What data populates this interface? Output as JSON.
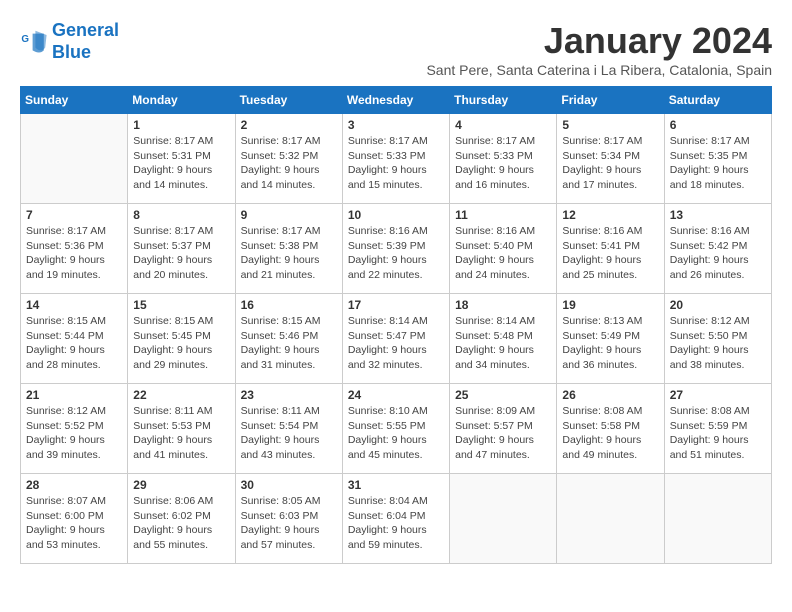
{
  "header": {
    "logo_line1": "General",
    "logo_line2": "Blue",
    "month": "January 2024",
    "subtitle": "Sant Pere, Santa Caterina i La Ribera, Catalonia, Spain"
  },
  "weekdays": [
    "Sunday",
    "Monday",
    "Tuesday",
    "Wednesday",
    "Thursday",
    "Friday",
    "Saturday"
  ],
  "weeks": [
    [
      {
        "day": "",
        "empty": true
      },
      {
        "day": "1",
        "sunrise": "8:17 AM",
        "sunset": "5:31 PM",
        "daylight": "9 hours and 14 minutes."
      },
      {
        "day": "2",
        "sunrise": "8:17 AM",
        "sunset": "5:32 PM",
        "daylight": "9 hours and 14 minutes."
      },
      {
        "day": "3",
        "sunrise": "8:17 AM",
        "sunset": "5:33 PM",
        "daylight": "9 hours and 15 minutes."
      },
      {
        "day": "4",
        "sunrise": "8:17 AM",
        "sunset": "5:33 PM",
        "daylight": "9 hours and 16 minutes."
      },
      {
        "day": "5",
        "sunrise": "8:17 AM",
        "sunset": "5:34 PM",
        "daylight": "9 hours and 17 minutes."
      },
      {
        "day": "6",
        "sunrise": "8:17 AM",
        "sunset": "5:35 PM",
        "daylight": "9 hours and 18 minutes."
      }
    ],
    [
      {
        "day": "7",
        "sunrise": "8:17 AM",
        "sunset": "5:36 PM",
        "daylight": "9 hours and 19 minutes."
      },
      {
        "day": "8",
        "sunrise": "8:17 AM",
        "sunset": "5:37 PM",
        "daylight": "9 hours and 20 minutes."
      },
      {
        "day": "9",
        "sunrise": "8:17 AM",
        "sunset": "5:38 PM",
        "daylight": "9 hours and 21 minutes."
      },
      {
        "day": "10",
        "sunrise": "8:16 AM",
        "sunset": "5:39 PM",
        "daylight": "9 hours and 22 minutes."
      },
      {
        "day": "11",
        "sunrise": "8:16 AM",
        "sunset": "5:40 PM",
        "daylight": "9 hours and 24 minutes."
      },
      {
        "day": "12",
        "sunrise": "8:16 AM",
        "sunset": "5:41 PM",
        "daylight": "9 hours and 25 minutes."
      },
      {
        "day": "13",
        "sunrise": "8:16 AM",
        "sunset": "5:42 PM",
        "daylight": "9 hours and 26 minutes."
      }
    ],
    [
      {
        "day": "14",
        "sunrise": "8:15 AM",
        "sunset": "5:44 PM",
        "daylight": "9 hours and 28 minutes."
      },
      {
        "day": "15",
        "sunrise": "8:15 AM",
        "sunset": "5:45 PM",
        "daylight": "9 hours and 29 minutes."
      },
      {
        "day": "16",
        "sunrise": "8:15 AM",
        "sunset": "5:46 PM",
        "daylight": "9 hours and 31 minutes."
      },
      {
        "day": "17",
        "sunrise": "8:14 AM",
        "sunset": "5:47 PM",
        "daylight": "9 hours and 32 minutes."
      },
      {
        "day": "18",
        "sunrise": "8:14 AM",
        "sunset": "5:48 PM",
        "daylight": "9 hours and 34 minutes."
      },
      {
        "day": "19",
        "sunrise": "8:13 AM",
        "sunset": "5:49 PM",
        "daylight": "9 hours and 36 minutes."
      },
      {
        "day": "20",
        "sunrise": "8:12 AM",
        "sunset": "5:50 PM",
        "daylight": "9 hours and 38 minutes."
      }
    ],
    [
      {
        "day": "21",
        "sunrise": "8:12 AM",
        "sunset": "5:52 PM",
        "daylight": "9 hours and 39 minutes."
      },
      {
        "day": "22",
        "sunrise": "8:11 AM",
        "sunset": "5:53 PM",
        "daylight": "9 hours and 41 minutes."
      },
      {
        "day": "23",
        "sunrise": "8:11 AM",
        "sunset": "5:54 PM",
        "daylight": "9 hours and 43 minutes."
      },
      {
        "day": "24",
        "sunrise": "8:10 AM",
        "sunset": "5:55 PM",
        "daylight": "9 hours and 45 minutes."
      },
      {
        "day": "25",
        "sunrise": "8:09 AM",
        "sunset": "5:57 PM",
        "daylight": "9 hours and 47 minutes."
      },
      {
        "day": "26",
        "sunrise": "8:08 AM",
        "sunset": "5:58 PM",
        "daylight": "9 hours and 49 minutes."
      },
      {
        "day": "27",
        "sunrise": "8:08 AM",
        "sunset": "5:59 PM",
        "daylight": "9 hours and 51 minutes."
      }
    ],
    [
      {
        "day": "28",
        "sunrise": "8:07 AM",
        "sunset": "6:00 PM",
        "daylight": "9 hours and 53 minutes."
      },
      {
        "day": "29",
        "sunrise": "8:06 AM",
        "sunset": "6:02 PM",
        "daylight": "9 hours and 55 minutes."
      },
      {
        "day": "30",
        "sunrise": "8:05 AM",
        "sunset": "6:03 PM",
        "daylight": "9 hours and 57 minutes."
      },
      {
        "day": "31",
        "sunrise": "8:04 AM",
        "sunset": "6:04 PM",
        "daylight": "9 hours and 59 minutes."
      },
      {
        "day": "",
        "empty": true
      },
      {
        "day": "",
        "empty": true
      },
      {
        "day": "",
        "empty": true
      }
    ]
  ]
}
